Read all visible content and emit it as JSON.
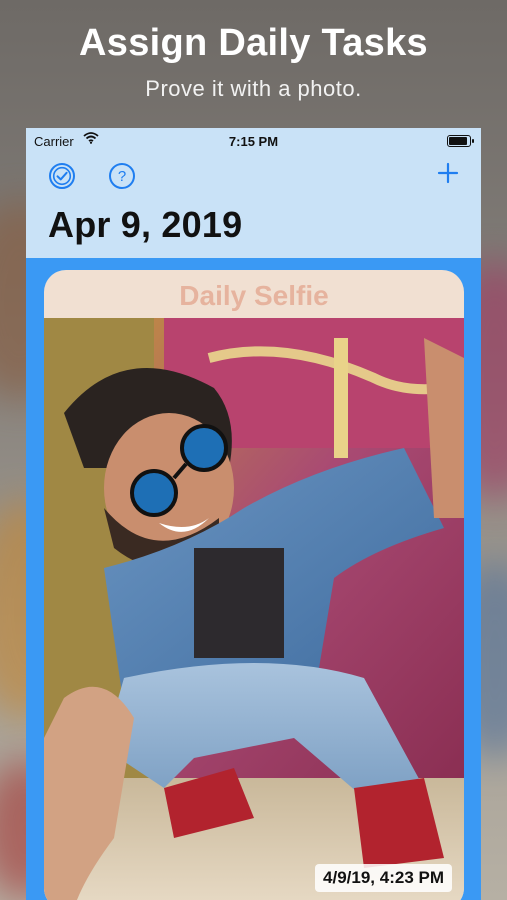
{
  "promo": {
    "title": "Assign Daily Tasks",
    "subtitle": "Prove it with a photo."
  },
  "status_bar": {
    "carrier": "Carrier",
    "time": "7:15 PM"
  },
  "nav": {
    "icons": [
      "checkmark-circle-icon",
      "help-icon",
      "add-icon"
    ]
  },
  "header": {
    "date": "Apr 9, 2019"
  },
  "card": {
    "title": "Daily Selfie",
    "timestamp": "4/9/19, 4:23 PM"
  },
  "colors": {
    "accent": "#3a99f4",
    "header_bg": "#c9e2f7",
    "card_title": "#e6b39e"
  }
}
